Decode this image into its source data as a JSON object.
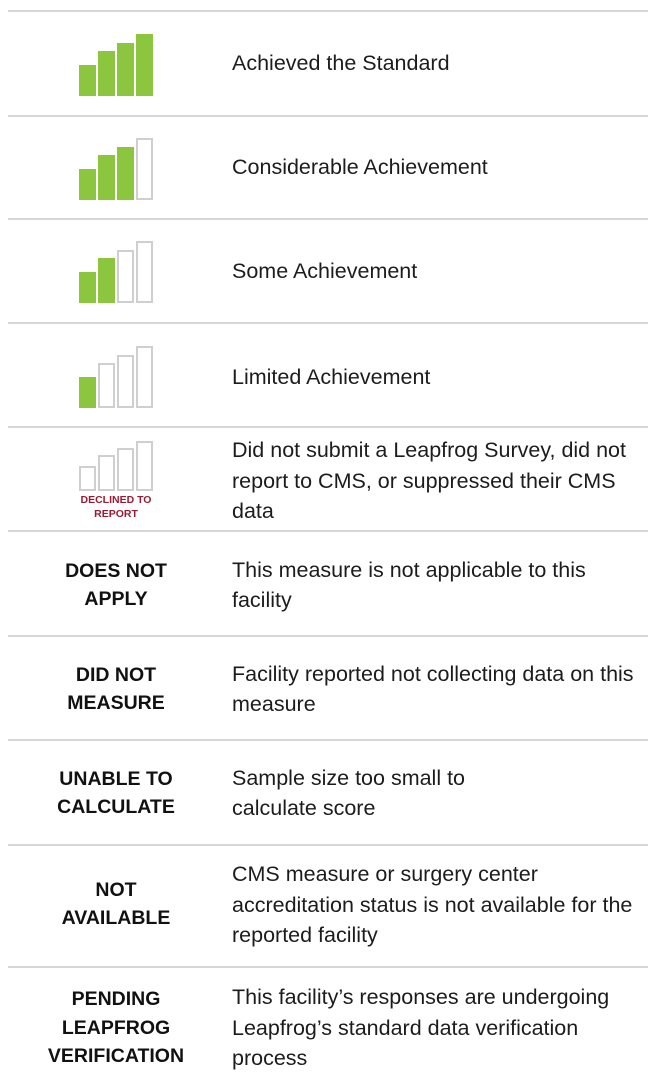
{
  "colors": {
    "filled": "#8cc63f",
    "empty_stroke": "#cfcfcf",
    "divider": "#d6d6d6",
    "declined_text": "#9b1a33"
  },
  "levels": [
    {
      "icon": "four-of-four-bars-icon",
      "filled_bars": 4,
      "total_bars": 4,
      "description": "Achieved the Standard"
    },
    {
      "icon": "three-of-four-bars-icon",
      "filled_bars": 3,
      "total_bars": 4,
      "description": "Considerable Achievement"
    },
    {
      "icon": "two-of-four-bars-icon",
      "filled_bars": 2,
      "total_bars": 4,
      "description": "Some Achievement"
    },
    {
      "icon": "one-of-four-bars-icon",
      "filled_bars": 1,
      "total_bars": 4,
      "description": "Limited Achievement"
    },
    {
      "icon": "zero-of-four-bars-icon",
      "filled_bars": 0,
      "total_bars": 4,
      "badge_line1": "DECLINED TO",
      "badge_line2": "REPORT",
      "description": "Did not submit a Leapfrog Survey, did not report to CMS, or suppressed their CMS data"
    }
  ],
  "statuses": [
    {
      "label": "DOES NOT APPLY",
      "description": "This measure is not applicable to this facility"
    },
    {
      "label": "DID NOT MEASURE",
      "description": "Facility reported not collecting data on this measure"
    },
    {
      "label": "UNABLE TO CALCULATE",
      "description": "Sample size too small to calculate score"
    },
    {
      "label": "NOT AVAILABLE",
      "description": "CMS measure or surgery center accreditation status is not available for the reported facility"
    },
    {
      "label": "PENDING LEAPFROG VERIFICATION",
      "description": "This facility’s responses are undergoing Leapfrog’s standard data verification process"
    }
  ]
}
